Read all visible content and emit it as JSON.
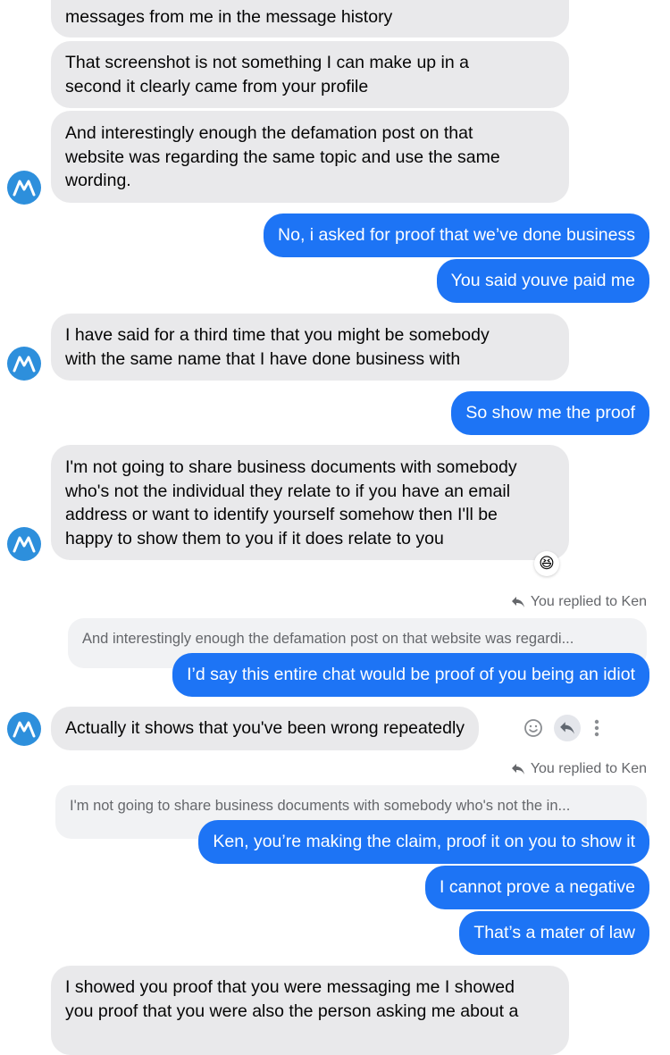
{
  "messages": {
    "m1": "messages from me in the message history",
    "m2": [
      "That screenshot is not something I can make up in a",
      "second it clearly came from your profile"
    ],
    "m3": [
      "And interestingly enough the defamation post on that",
      "website was regarding the same topic and use the same",
      "wording."
    ],
    "m4": "No, i asked for proof that we’ve done business",
    "m5": "You said youve paid me",
    "m6": [
      "I have said for a third time that you might be somebody",
      "with the same name that I have done business with"
    ],
    "m7": "So show me the proof",
    "m8": [
      "I'm not going to share business documents with somebody",
      "who's not the individual they relate to if you have an email",
      "address or want to identify yourself somehow then I'll be",
      "happy to show them to you if it does relate to you"
    ],
    "m8_reaction": "😆",
    "reply1_hint": "You replied to Ken",
    "reply1_quote": "And interestingly enough the defamation post on that website was regardi...",
    "m9": "I’d say this entire chat would be proof of you being an idiot",
    "m10": "Actually it shows that you've been wrong repeatedly",
    "reply2_hint": "You replied to Ken",
    "reply2_quote": "I'm not going to share business documents with somebody who's not the in...",
    "m11": "Ken, you’re making the claim, proof it on you to show it",
    "m12": "I cannot prove a negative",
    "m13": "That’s a mater of law",
    "m14": [
      "I showed you proof that you were messaging me I showed",
      "you proof that you were also the person asking me about a"
    ]
  },
  "icons": {
    "avatar": "motorola-logo-icon",
    "reply": "reply-arrow-icon",
    "react": "smiley-icon",
    "more": "more-vertical-icon"
  },
  "colors": {
    "incoming_bubble": "#e9e9eb",
    "outgoing_bubble": "#1d74f5",
    "avatar": "#2d8fdc",
    "meta_text": "#65676b"
  }
}
